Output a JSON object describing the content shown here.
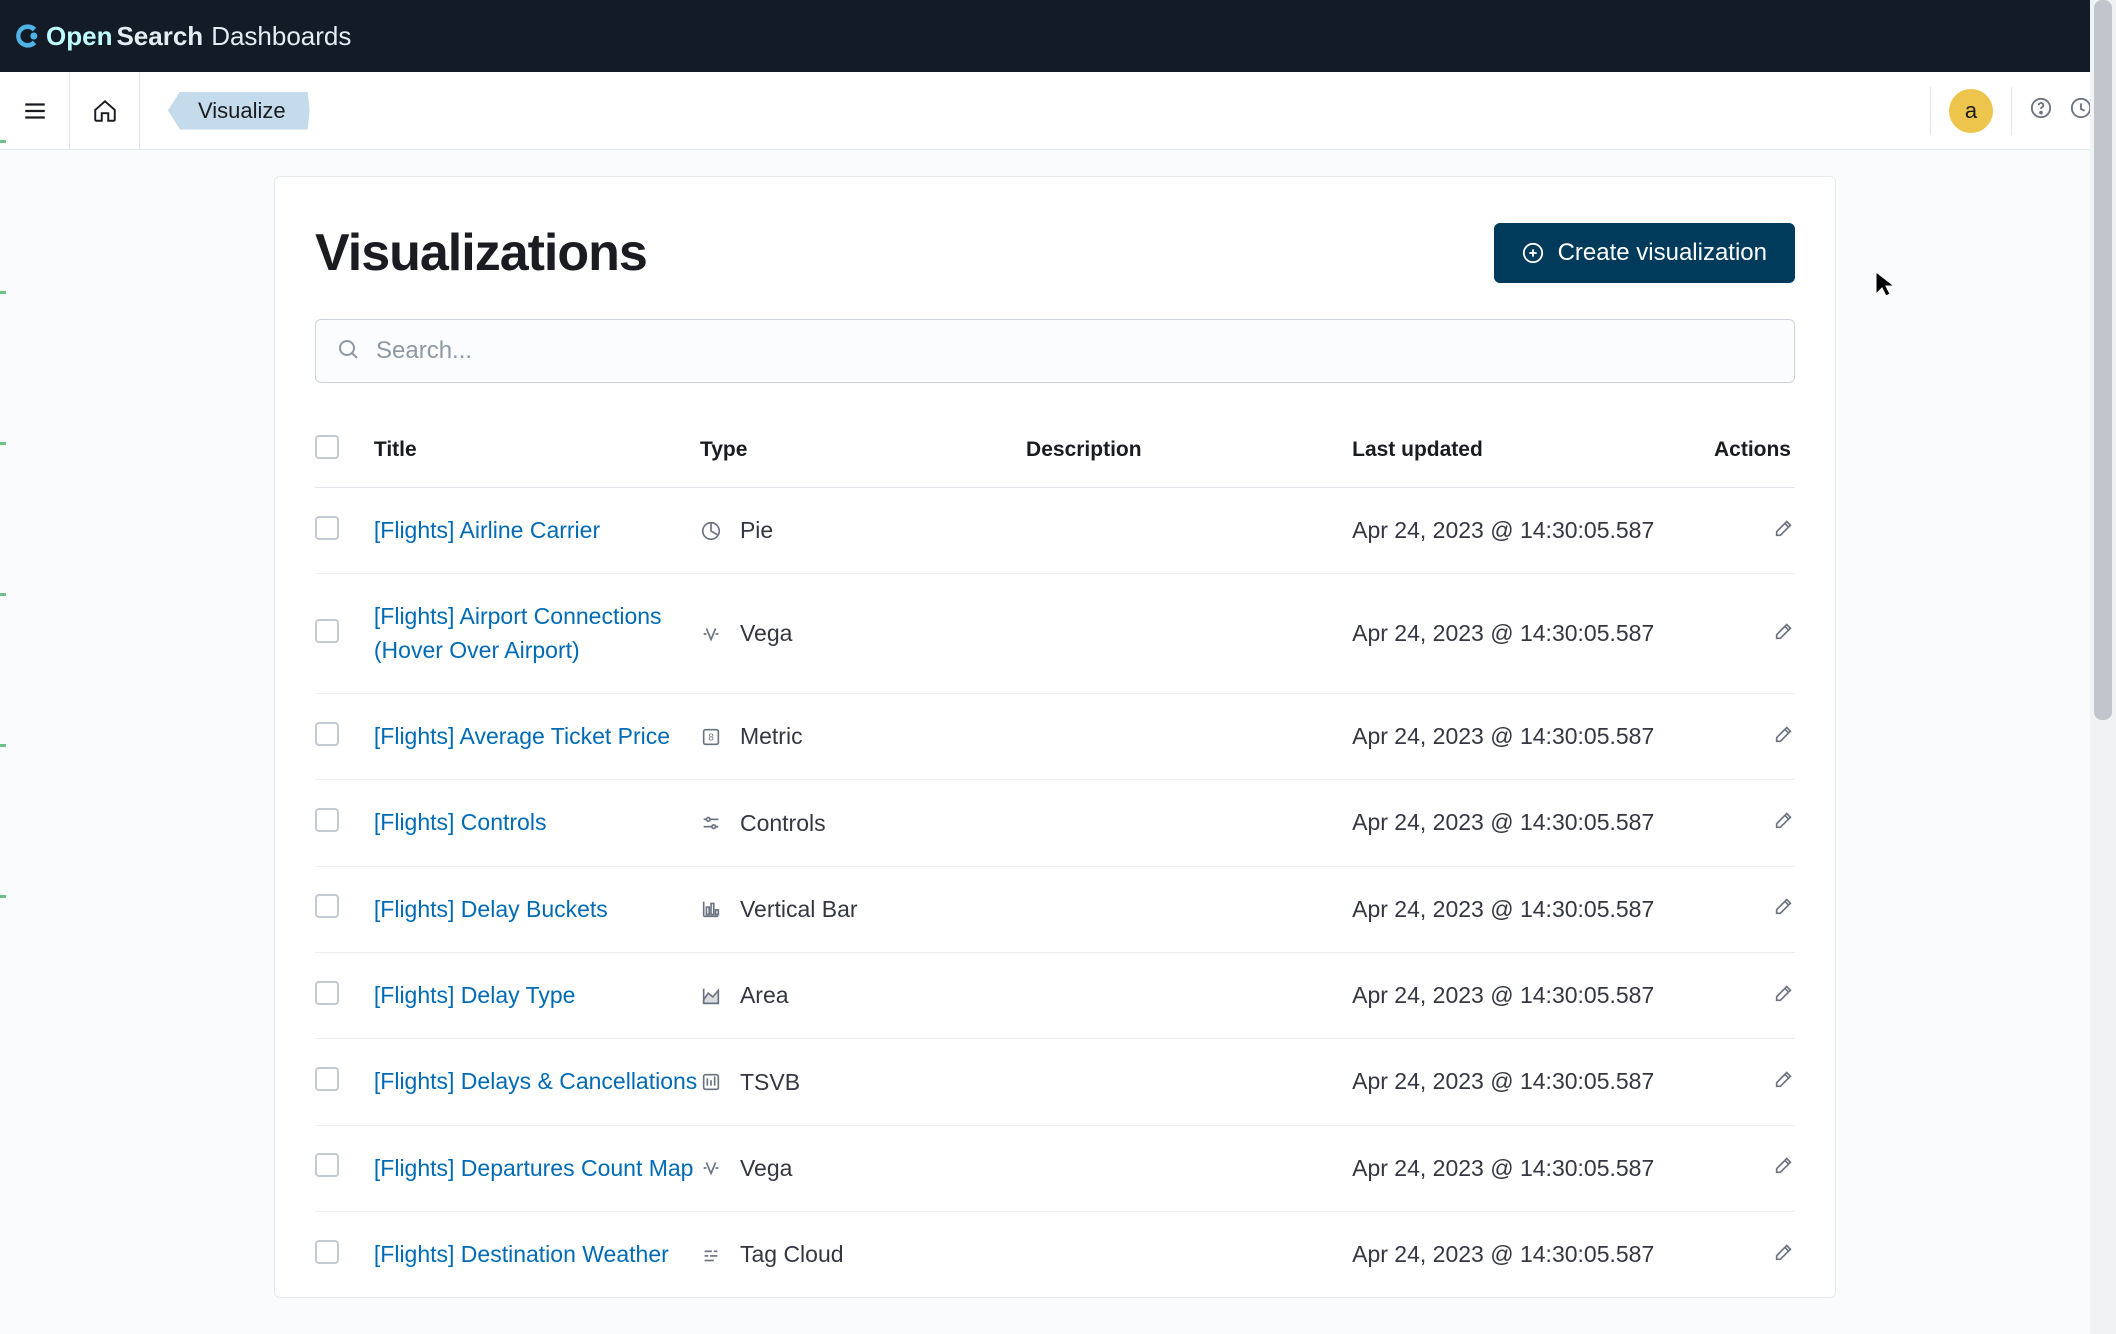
{
  "brand": {
    "open": "Open",
    "search": "Search",
    "dash": "Dashboards"
  },
  "nav": {
    "breadcrumb": "Visualize",
    "avatar": "a"
  },
  "page": {
    "title": "Visualizations",
    "create_label": "Create visualization"
  },
  "search": {
    "placeholder": "Search..."
  },
  "columns": {
    "title": "Title",
    "type": "Type",
    "description": "Description",
    "updated": "Last updated",
    "actions": "Actions"
  },
  "rows": [
    {
      "title": "[Flights] Airline Carrier",
      "type": "Pie",
      "type_icon": "pie",
      "description": "",
      "updated": "Apr 24, 2023 @ 14:30:05.587"
    },
    {
      "title": "[Flights] Airport Connections (Hover Over Airport)",
      "type": "Vega",
      "type_icon": "vega",
      "description": "",
      "updated": "Apr 24, 2023 @ 14:30:05.587"
    },
    {
      "title": "[Flights] Average Ticket Price",
      "type": "Metric",
      "type_icon": "metric",
      "description": "",
      "updated": "Apr 24, 2023 @ 14:30:05.587"
    },
    {
      "title": "[Flights] Controls",
      "type": "Controls",
      "type_icon": "controls",
      "description": "",
      "updated": "Apr 24, 2023 @ 14:30:05.587"
    },
    {
      "title": "[Flights] Delay Buckets",
      "type": "Vertical Bar",
      "type_icon": "vbar",
      "description": "",
      "updated": "Apr 24, 2023 @ 14:30:05.587"
    },
    {
      "title": "[Flights] Delay Type",
      "type": "Area",
      "type_icon": "area",
      "description": "",
      "updated": "Apr 24, 2023 @ 14:30:05.587"
    },
    {
      "title": "[Flights] Delays & Cancellations",
      "type": "TSVB",
      "type_icon": "tsvb",
      "description": "",
      "updated": "Apr 24, 2023 @ 14:30:05.587"
    },
    {
      "title": "[Flights] Departures Count Map",
      "type": "Vega",
      "type_icon": "vega",
      "description": "",
      "updated": "Apr 24, 2023 @ 14:30:05.587"
    },
    {
      "title": "[Flights] Destination Weather",
      "type": "Tag Cloud",
      "type_icon": "tagcloud",
      "description": "",
      "updated": "Apr 24, 2023 @ 14:30:05.587"
    }
  ]
}
